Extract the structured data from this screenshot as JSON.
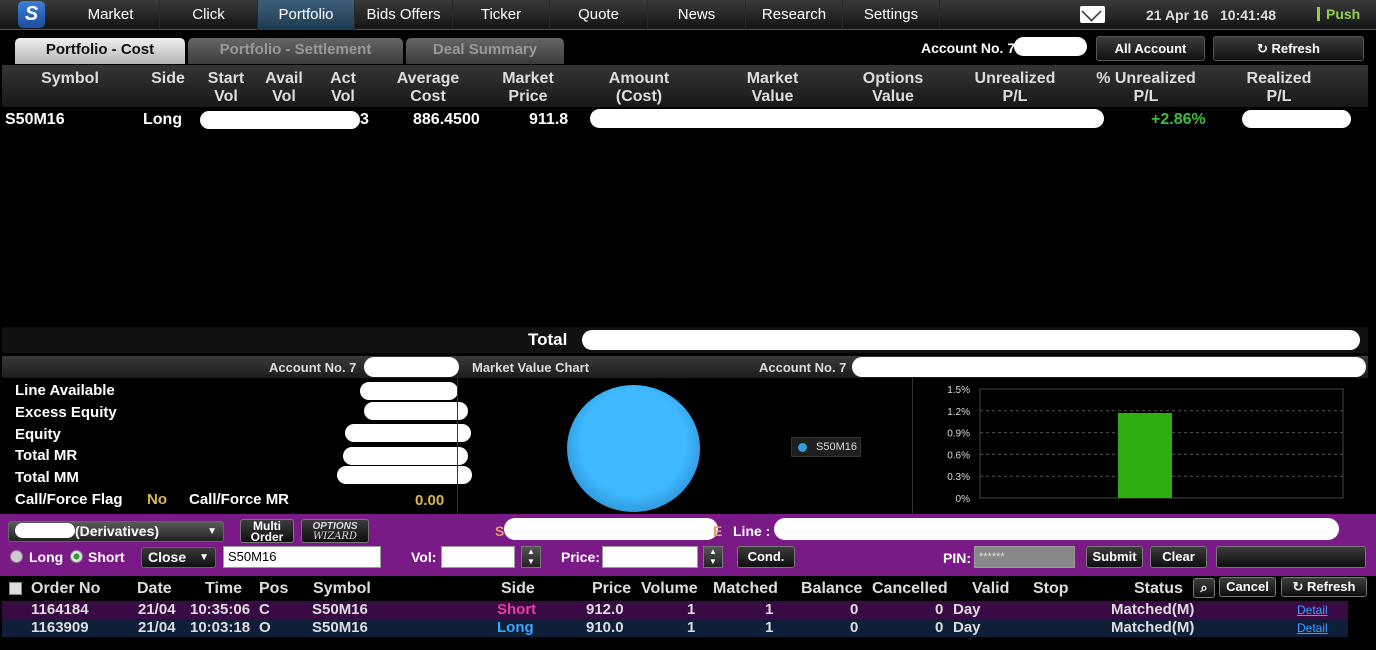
{
  "nav": {
    "logo": "S",
    "items": [
      "Market",
      "Click",
      "Portfolio",
      "Bids Offers",
      "Ticker",
      "Quote",
      "News",
      "Research",
      "Settings"
    ],
    "active": "Portfolio",
    "date": "21 Apr 16",
    "time": "10:41:48",
    "push": "Push"
  },
  "tabs": [
    "Portfolio - Cost",
    "Portfolio - Settlement",
    "Deal Summary"
  ],
  "header": {
    "account_label": "Account No. 7",
    "all_account": "All Account",
    "refresh": "Refresh"
  },
  "portfolio": {
    "columns": [
      "Symbol",
      "Side",
      "Start Vol",
      "Avail Vol",
      "Act Vol",
      "Average Cost",
      "Market Price",
      "Amount (Cost)",
      "Market Value",
      "Options Value",
      "Unrealized P/L",
      "% Unrealized P/L",
      "Realized P/L"
    ],
    "col_lines": [
      [
        "Symbol"
      ],
      [
        "Side"
      ],
      [
        "Start",
        "Vol"
      ],
      [
        "Avail",
        "Vol"
      ],
      [
        "Act",
        "Vol"
      ],
      [
        "Average",
        "Cost"
      ],
      [
        "Market",
        "Price"
      ],
      [
        "Amount",
        "(Cost)"
      ],
      [
        "Market",
        "Value"
      ],
      [
        "Options",
        "Value"
      ],
      [
        "Unrealized",
        "P/L"
      ],
      [
        "% Unrealized",
        "P/L"
      ],
      [
        "Realized",
        "P/L"
      ]
    ],
    "rows": [
      {
        "symbol": "S50M16",
        "side": "Long",
        "act_vol_tail": "3",
        "avg_cost": "886.4500",
        "market_price": "911.8",
        "pct_unrealized": "+2.86%"
      }
    ],
    "total_label": "Total"
  },
  "summary": {
    "left_header": "Account No. 7",
    "center_header": "Market Value Chart",
    "right_header": "Account No. 7",
    "labels": [
      "Line Available",
      "Excess Equity",
      "Equity",
      "Total MR",
      "Total MM"
    ],
    "call_force_flag_label": "Call/Force Flag",
    "call_force_flag_value": "No",
    "call_force_mr_label": "Call/Force MR",
    "call_force_mr_value": "0.00"
  },
  "pie_legend": "S50M16",
  "chart_data": {
    "type": "bar",
    "categories": [
      "S50M16"
    ],
    "values": [
      1.17
    ],
    "yticks": [
      "1.5%",
      "1.2%",
      "0.9%",
      "0.6%",
      "0.3%",
      "0%"
    ],
    "ylim": [
      0,
      1.5
    ],
    "grid": true,
    "bar_color": "#2fae0f"
  },
  "order_entry": {
    "account_suffix": "(Derivatives)",
    "multi_order_line1": "Multi",
    "multi_order_line2": "Order",
    "options_wizard_line1": "OPTIONS",
    "options_wizard_line2": "WIZARD",
    "line_label": "Line :",
    "long_label": "Long",
    "short_label": "Short",
    "position_value": "Close",
    "symbol_value": "S50M16",
    "vol_label": "Vol:",
    "price_label": "Price:",
    "cond_label": "Cond.",
    "pin_label": "PIN:",
    "pin_value": "******",
    "submit_label": "Submit",
    "clear_label": "Clear",
    "s_fragment": "S",
    "e_fragment": "E"
  },
  "orders": {
    "columns": [
      "Order No",
      "Date",
      "Time",
      "Pos",
      "Symbol",
      "Side",
      "Price",
      "Volume",
      "Matched",
      "Balance",
      "Cancelled",
      "Valid",
      "Stop",
      "Status"
    ],
    "cancel_label": "Cancel",
    "refresh_label": "Refresh",
    "rows": [
      {
        "order_no": "1164184",
        "date": "21/04",
        "time": "10:35:06",
        "pos": "C",
        "symbol": "S50M16",
        "side": "Short",
        "price": "912.0",
        "volume": "1",
        "matched": "1",
        "balance": "0",
        "cancelled": "0",
        "valid": "Day",
        "stop": "",
        "status": "Matched(M)",
        "detail": "Detail"
      },
      {
        "order_no": "1163909",
        "date": "21/04",
        "time": "10:03:18",
        "pos": "O",
        "symbol": "S50M16",
        "side": "Long",
        "price": "910.0",
        "volume": "1",
        "matched": "1",
        "balance": "0",
        "cancelled": "0",
        "valid": "Day",
        "stop": "",
        "status": "Matched(M)",
        "detail": "Detail"
      }
    ]
  },
  "colors": {
    "order_bar": "#7a1a86",
    "short": "#e83aa8",
    "long": "#3aa6ff",
    "positive": "#3dbd3d",
    "flag": "#d6b84a"
  }
}
